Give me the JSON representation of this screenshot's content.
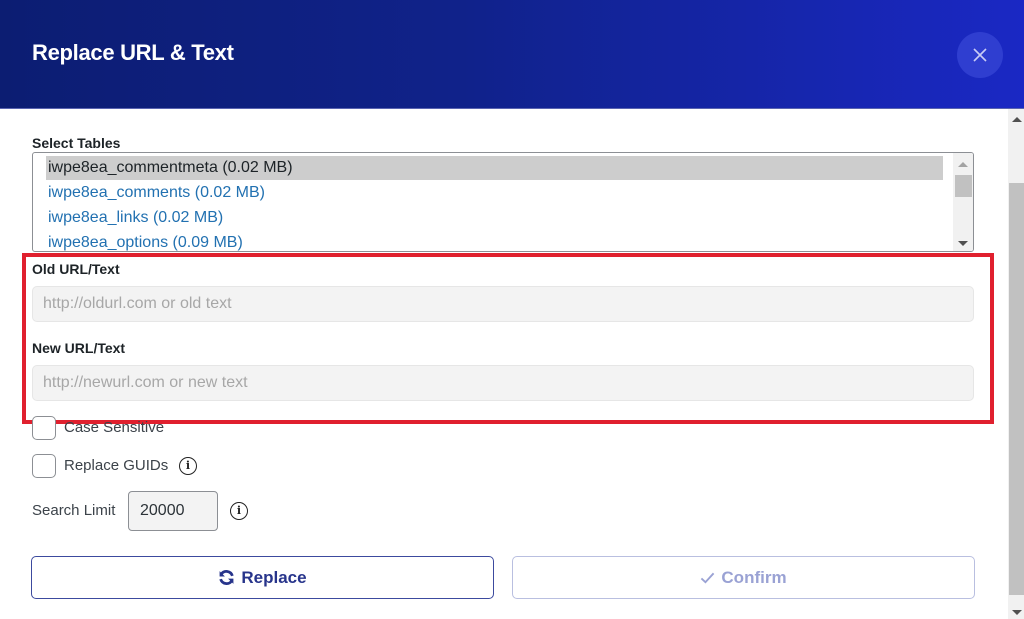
{
  "dialog": {
    "title": "Replace URL & Text",
    "close_icon": "close-icon"
  },
  "select_tables": {
    "label": "Select Tables",
    "items": [
      {
        "label": "iwpe8ea_commentmeta (0.02 MB)",
        "selected": true
      },
      {
        "label": "iwpe8ea_comments (0.02 MB)",
        "selected": false
      },
      {
        "label": "iwpe8ea_links (0.02 MB)",
        "selected": false
      },
      {
        "label": "iwpe8ea_options (0.09 MB)",
        "selected": false
      }
    ]
  },
  "old_url": {
    "label": "Old URL/Text",
    "value": "",
    "placeholder": "http://oldurl.com or old text"
  },
  "new_url": {
    "label": "New URL/Text",
    "value": "",
    "placeholder": "http://newurl.com or new text"
  },
  "options": {
    "case_sensitive": {
      "label": "Case Sensitive",
      "checked": false
    },
    "replace_guids": {
      "label": "Replace GUIDs",
      "checked": false,
      "info_icon": "info-icon"
    }
  },
  "search_limit": {
    "label": "Search Limit",
    "value": "20000",
    "info_icon": "info-icon"
  },
  "buttons": {
    "replace": {
      "label": "Replace",
      "icon": "refresh-icon"
    },
    "confirm": {
      "label": "Confirm",
      "icon": "check-icon"
    }
  },
  "colors": {
    "header_gradient_start": "#0c1d72",
    "header_gradient_end": "#1a28c4",
    "highlight": "#e0202e",
    "link": "#2271b1",
    "primary_button": "#27348b"
  }
}
